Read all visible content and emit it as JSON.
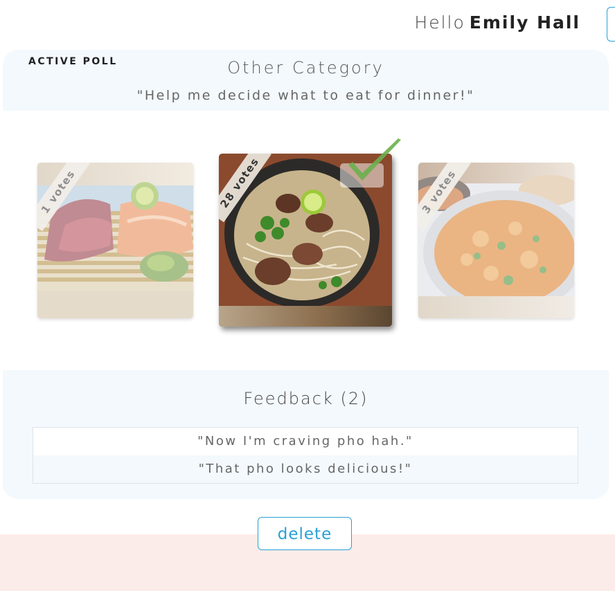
{
  "header": {
    "greeting": "Hello",
    "user_name": "Emily Hall"
  },
  "poll": {
    "status_label": "ACTIVE POLL",
    "category": "Other Category",
    "question": "\"Help me decide what to eat for dinner!\""
  },
  "options": [
    {
      "votes_label": "1 votes",
      "icon": "sashimi-photo",
      "selected": false
    },
    {
      "votes_label": "28 votes",
      "icon": "pho-photo",
      "selected": true
    },
    {
      "votes_label": "3 votes",
      "icon": "curry-photo",
      "selected": false
    }
  ],
  "feedback": {
    "title": "Feedback (2)",
    "items": [
      "\"Now I'm craving pho hah.\"",
      "\"That pho looks delicious!\""
    ]
  },
  "actions": {
    "delete_label": "delete"
  },
  "colors": {
    "accent": "#29a0d6",
    "panel_bg": "#f3f9fd",
    "footer_bg": "#fcece9",
    "check": "#6ab04c"
  }
}
